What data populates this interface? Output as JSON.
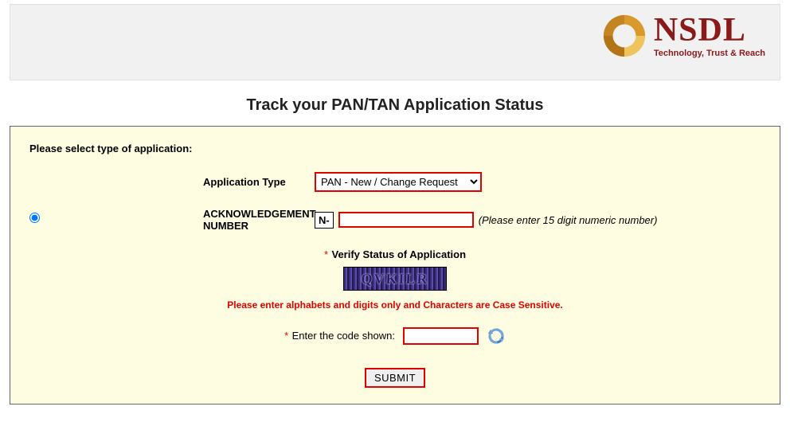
{
  "brand": {
    "name": "NSDL",
    "tagline": "Technology, Trust & Reach"
  },
  "page": {
    "title": "Track your PAN/TAN Application Status"
  },
  "form": {
    "instruction": "Please select type of application:",
    "field_app_type_label": "Application Type",
    "app_type_options": [
      "PAN - New / Change Request"
    ],
    "app_type_selected": "PAN - New / Change Request",
    "field_ack_label": "ACKNOWLEDGEMENT NUMBER",
    "ack_prefix": "N-",
    "ack_value": "",
    "ack_hint": "(Please enter 15 digit numeric number)",
    "verify_heading": "Verify Status of Application",
    "captcha_text": "QVKILR",
    "captcha_warning": "Please enter alphabets and digits only and Characters are Case Sensitive.",
    "code_label": "Enter the code shown:",
    "code_value": "",
    "submit_label": "SUBMIT"
  }
}
